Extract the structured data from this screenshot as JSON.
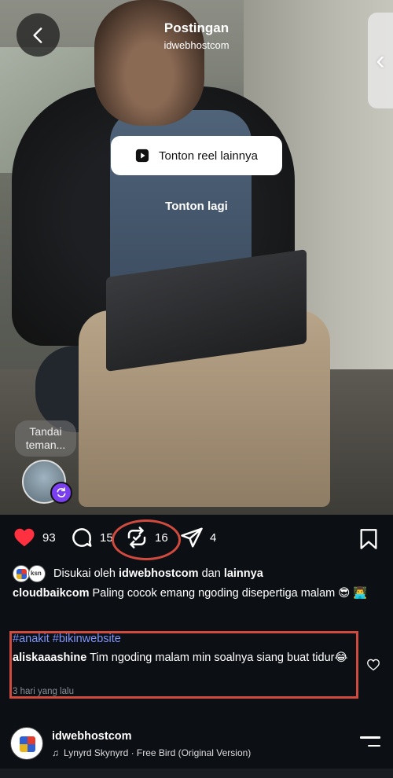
{
  "header": {
    "title": "Postingan",
    "subtitle": "idwebhostcom"
  },
  "video": {
    "watch_more_label": "Tonton reel lainnya",
    "replay_label": "Tonton lagi",
    "tag_people_label": "Tandai teman..."
  },
  "actions": {
    "likes_count": "93",
    "comments_count": "15",
    "reposts_count": "16",
    "shares_count": "4"
  },
  "liked_by": {
    "prefix": "Disukai oleh",
    "user": "idwebhostcom",
    "connector": "dan",
    "others": "lainnya"
  },
  "caption": {
    "user": "cloudbaikcom",
    "text": "Paling cocok emang ngoding disepertiga malam 😎 👨‍💻"
  },
  "hashtags": "#anakit #bikinwebsite",
  "comment": {
    "user": "aliskaaashine",
    "text": "Tim ngoding malam min soalnya siang buat tidur😂",
    "time": "3 hari yang lalu"
  },
  "music": {
    "user": "idwebhostcom",
    "track": "Lynyrd Skynyrd · Free Bird (Original Version)"
  },
  "colors": {
    "like_red": "#ff3040",
    "annotation_red": "#d04a3e",
    "hashtag_blue": "#7c95ff",
    "remix_purple": "#7a3ff0",
    "panel_bg": "#0c0f14"
  }
}
